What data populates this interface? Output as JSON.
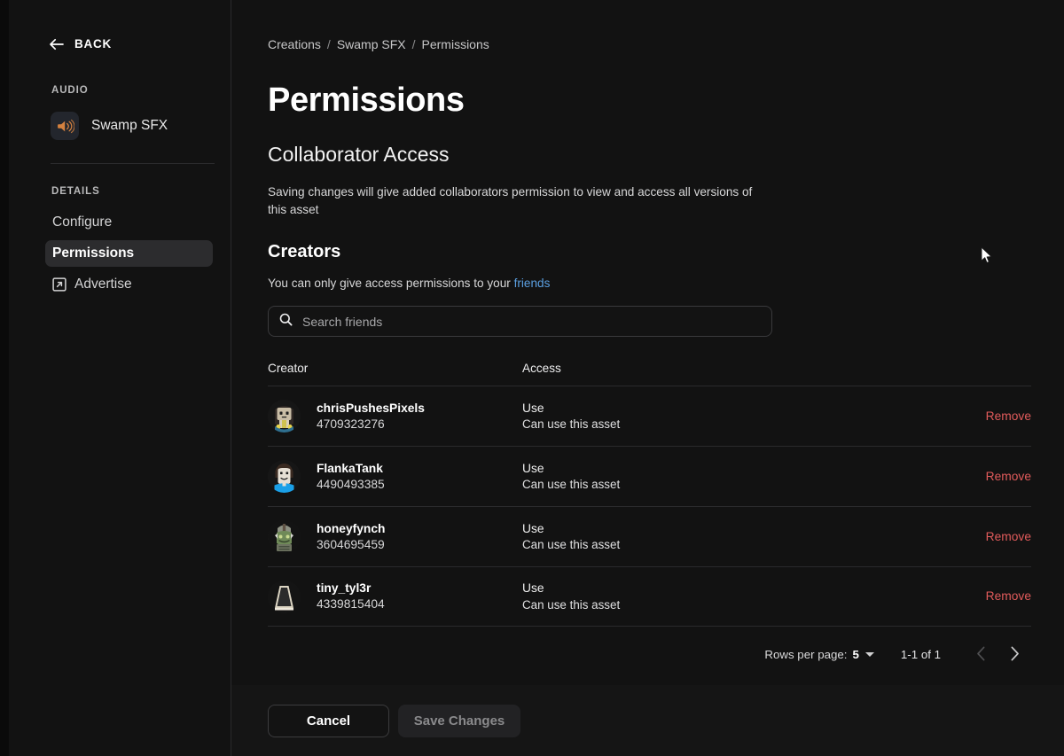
{
  "sidebar": {
    "back_label": "BACK",
    "audio_section_label": "AUDIO",
    "asset_name": "Swamp SFX",
    "details_section_label": "DETAILS",
    "nav_items": [
      {
        "label": "Configure",
        "active": false,
        "icon": ""
      },
      {
        "label": "Permissions",
        "active": true,
        "icon": ""
      },
      {
        "label": "Advertise",
        "active": false,
        "icon": "external-link-icon"
      }
    ]
  },
  "breadcrumb": {
    "items": [
      "Creations",
      "Swamp SFX",
      "Permissions"
    ],
    "separator": "/"
  },
  "page": {
    "title": "Permissions",
    "section_title": "Collaborator Access",
    "section_desc": "Saving changes will give added collaborators permission to view and access all versions of this asset",
    "sub_title": "Creators",
    "sub_desc_prefix": "You can only give access permissions to your ",
    "sub_desc_link": "friends"
  },
  "search": {
    "placeholder": "Search friends",
    "value": ""
  },
  "table": {
    "columns": [
      "Creator",
      "Access",
      ""
    ],
    "action_label": "Remove",
    "rows": [
      {
        "username": "chrisPushesPixels",
        "user_id": "4709323276",
        "access_title": "Use",
        "access_desc": "Can use this asset",
        "avatar": "avatar-chrispushespixels"
      },
      {
        "username": "FlankaTank",
        "user_id": "4490493385",
        "access_title": "Use",
        "access_desc": "Can use this asset",
        "avatar": "avatar-flankatank"
      },
      {
        "username": "honeyfynch",
        "user_id": "3604695459",
        "access_title": "Use",
        "access_desc": "Can use this asset",
        "avatar": "avatar-honeyfynch"
      },
      {
        "username": "tiny_tyl3r",
        "user_id": "4339815404",
        "access_title": "Use",
        "access_desc": "Can use this asset",
        "avatar": "avatar-tiny-tyl3r"
      }
    ]
  },
  "pagination": {
    "rows_per_page_label": "Rows per page:",
    "rows_per_page_value": "5",
    "range_label": "1-1 of 1",
    "prev_enabled": false,
    "next_enabled": true
  },
  "footer": {
    "cancel_label": "Cancel",
    "save_label": "Save Changes",
    "save_enabled": false
  },
  "colors": {
    "background": "#121212",
    "sidebar_active": "#2c2c2e",
    "link": "#5b9fe0",
    "remove": "#e15b5b",
    "divider": "#2a2a2c",
    "audio_icon": "#d4813f"
  }
}
